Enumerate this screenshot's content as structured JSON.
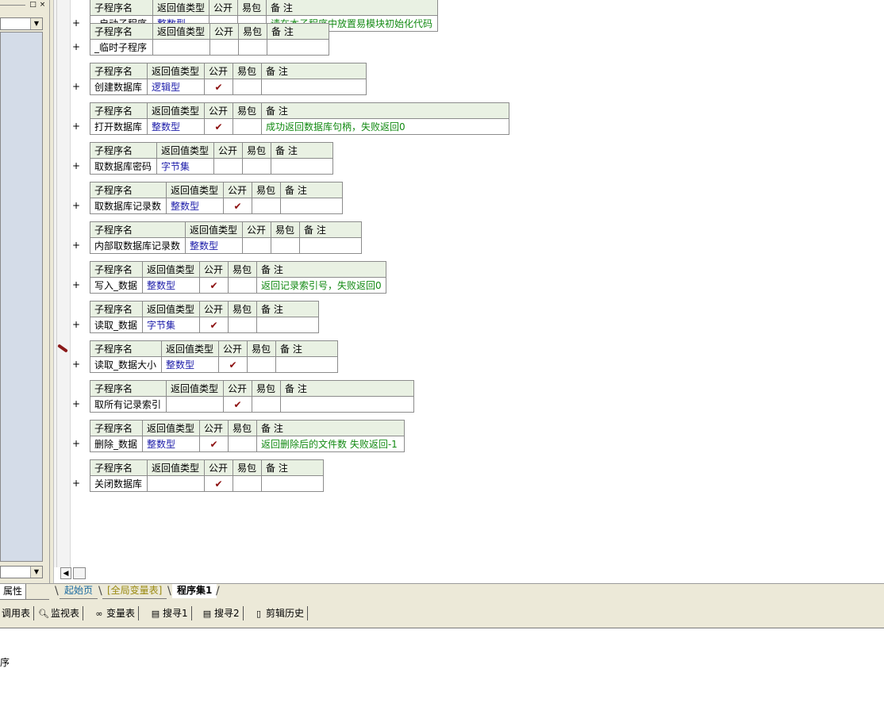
{
  "left_panel": {
    "window_buttons": [
      "□",
      "×"
    ],
    "tab_label": "属性"
  },
  "header_labels": {
    "name": "子程序名",
    "return_type": "返回值类型",
    "public": "公开",
    "easy_pkg": "易包",
    "note": "备 注"
  },
  "plus_sign": "+",
  "procedures": [
    {
      "name": "_启动子程序",
      "return_type": "整数型",
      "public": "",
      "easy_pkg": "",
      "note": "请在本子程序中放置易模块初始化代码"
    },
    {
      "name": "_临时子程序",
      "return_type": "",
      "public": "",
      "easy_pkg": "",
      "note": ""
    },
    {
      "name": "创建数据库",
      "return_type": "逻辑型",
      "public": "✔",
      "easy_pkg": "",
      "note": ""
    },
    {
      "name": "打开数据库",
      "return_type": "整数型",
      "public": "✔",
      "easy_pkg": "",
      "note": "成功返回数据库句柄，失败返回0"
    },
    {
      "name": "取数据库密码",
      "return_type": "字节集",
      "public": "",
      "easy_pkg": "",
      "note": ""
    },
    {
      "name": "取数据库记录数",
      "return_type": "整数型",
      "public": "✔",
      "easy_pkg": "",
      "note": ""
    },
    {
      "name": "内部取数据库记录数",
      "return_type": "整数型",
      "public": "",
      "easy_pkg": "",
      "note": ""
    },
    {
      "name": "写入_数据",
      "return_type": "整数型",
      "public": "✔",
      "easy_pkg": "",
      "note": "返回记录索引号，失败返回0"
    },
    {
      "name": "读取_数据",
      "return_type": "字节集",
      "public": "✔",
      "easy_pkg": "",
      "note": ""
    },
    {
      "name": "读取_数据大小",
      "return_type": "整数型",
      "public": "✔",
      "easy_pkg": "",
      "note": ""
    },
    {
      "name": "取所有记录索引",
      "return_type": "",
      "public": "✔",
      "easy_pkg": "",
      "note": ""
    },
    {
      "name": "删除_数据",
      "return_type": "整数型",
      "public": "✔",
      "easy_pkg": "",
      "note": "返回删除后的文件数 失败返回-1"
    },
    {
      "name": "关闭数据库",
      "return_type": "",
      "public": "✔",
      "easy_pkg": "",
      "note": ""
    }
  ],
  "document_tabs": [
    {
      "label": "起始页"
    },
    {
      "label": "[全局变量表]"
    },
    {
      "label": "程序集1"
    }
  ],
  "toolbar": [
    {
      "icon": "call-table-icon",
      "label": "调用表"
    },
    {
      "icon": "magnifier-icon",
      "label": "监视表"
    },
    {
      "icon": "glasses-icon",
      "label": "变量表"
    },
    {
      "icon": "search-page-icon",
      "label": "搜寻1"
    },
    {
      "icon": "search-page-icon",
      "label": "搜寻2"
    },
    {
      "icon": "clipboard-icon",
      "label": "剪辑历史"
    }
  ],
  "output_text": "序",
  "colors": {
    "header_bg": "#e9f1e3",
    "type_text": "#1a1aa8",
    "note_text": "#138a13",
    "check_mark": "#8b0d0d",
    "tree_bg": "#d4dce8"
  }
}
